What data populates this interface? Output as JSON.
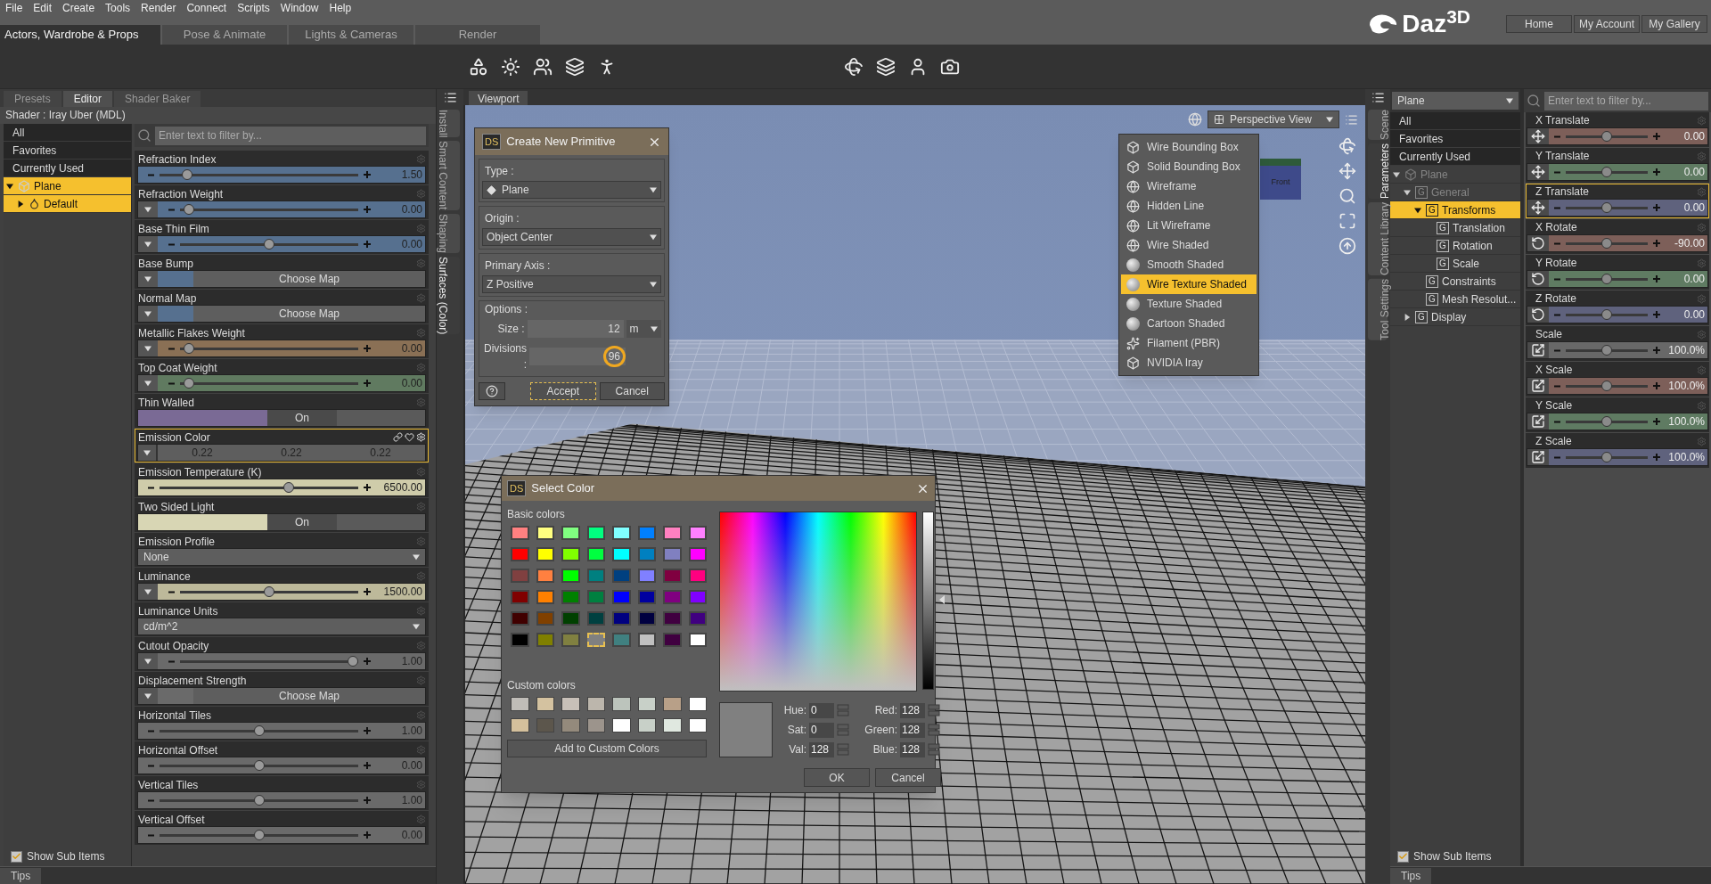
{
  "menu_bar": [
    "File",
    "Edit",
    "Create",
    "Tools",
    "Render",
    "Connect",
    "Scripts",
    "Window",
    "Help"
  ],
  "rooms": [
    {
      "label": "Actors, Wardrobe & Props",
      "selected": true
    },
    {
      "label": "Pose & Animate",
      "selected": false
    },
    {
      "label": "Lights & Cameras",
      "selected": false
    },
    {
      "label": "Render",
      "selected": false
    }
  ],
  "logo": "Daz$^{3D}$",
  "account_buttons": [
    "Home",
    "My Account",
    "My Gallery"
  ],
  "left_panel": {
    "tabs": [
      {
        "label": "Presets",
        "selected": false
      },
      {
        "label": "Editor",
        "selected": true
      },
      {
        "label": "Shader Baker",
        "selected": false
      }
    ],
    "shader": "Shader : Iray Uber (MDL)",
    "filters": [
      {
        "label": "All",
        "selected": false
      },
      {
        "label": "Favorites",
        "selected": false
      },
      {
        "label": "Currently Used",
        "selected": false
      }
    ],
    "tree": [
      {
        "label": "Plane",
        "kind": "node",
        "selected": true,
        "expanded": true,
        "children": [
          {
            "label": "Default",
            "kind": "material",
            "selected": true,
            "expanded": false
          }
        ]
      }
    ],
    "filter_placeholder": "Enter text to filter by...",
    "properties": [
      {
        "label": "Refraction Index",
        "kind": "slider",
        "menu": false,
        "level": 0.12,
        "value": "1.50",
        "color": "#56708f",
        "selected": false
      },
      {
        "label": "Refraction Weight",
        "kind": "slider",
        "menu": true,
        "level": 0.02,
        "value": "0.00",
        "color": "#56708f",
        "selected": false
      },
      {
        "label": "Base Thin Film",
        "kind": "slider",
        "menu": true,
        "level": 0.5,
        "value": "0.00",
        "color": "#56708f",
        "selected": false
      },
      {
        "label": "Base Bump",
        "kind": "map",
        "menu": true,
        "value": "Choose Map",
        "color": "#56708f",
        "selected": false
      },
      {
        "label": "Normal Map",
        "kind": "map",
        "menu": true,
        "value": "Choose Map",
        "color": "#56708f",
        "selected": false
      },
      {
        "label": "Metallic Flakes Weight",
        "kind": "slider",
        "menu": true,
        "level": 0.02,
        "value": "0.00",
        "color": "#8a7055",
        "selected": false
      },
      {
        "label": "Top Coat Weight",
        "kind": "slider",
        "menu": true,
        "level": 0.02,
        "value": "0.00",
        "color": "#607a60",
        "selected": false
      },
      {
        "label": "Thin Walled",
        "kind": "toggle",
        "value": "On",
        "color": "#7a6a95",
        "selected": false
      },
      {
        "label": "Emission Color",
        "kind": "color",
        "menu": true,
        "values": [
          "0.22",
          "0.22",
          "0.22"
        ],
        "selected": true
      },
      {
        "label": "Emission Temperature (K)",
        "kind": "slider",
        "menu": false,
        "level": 0.66,
        "value": "6500.00",
        "color": "#cfccaa",
        "selected": false
      },
      {
        "label": "Two Sided Light",
        "kind": "toggle",
        "value": "On",
        "color": "#d8d6b4",
        "selected": false
      },
      {
        "label": "Emission Profile",
        "kind": "dropdown",
        "value": "None",
        "selected": false
      },
      {
        "label": "Luminance",
        "kind": "slider",
        "menu": true,
        "level": 0.5,
        "value": "1500.00",
        "color": "#bdb99a",
        "selected": false
      },
      {
        "label": "Luminance Units",
        "kind": "dropdown",
        "value": "cd/m^2",
        "selected": false
      },
      {
        "label": "Cutout Opacity",
        "kind": "slider",
        "menu": true,
        "level": 1.0,
        "value": "1.00",
        "color": "#6a6a6a",
        "selected": false
      },
      {
        "label": "Displacement Strength",
        "kind": "map",
        "menu": true,
        "value": "Choose Map",
        "color": "#6a6a6a",
        "selected": false
      },
      {
        "label": "Horizontal Tiles",
        "kind": "slider",
        "menu": false,
        "level": 0.5,
        "value": "1.00",
        "color": "#6a6a6a",
        "selected": false
      },
      {
        "label": "Horizontal Offset",
        "kind": "slider",
        "menu": false,
        "level": 0.5,
        "value": "0.00",
        "color": "#6a6a6a",
        "selected": false
      },
      {
        "label": "Vertical Tiles",
        "kind": "slider",
        "menu": false,
        "level": 0.5,
        "value": "1.00",
        "color": "#6a6a6a",
        "selected": false
      },
      {
        "label": "Vertical Offset",
        "kind": "slider",
        "menu": false,
        "level": 0.5,
        "value": "0.00",
        "color": "#6a6a6a",
        "selected": false
      }
    ],
    "show_sub_items": {
      "label": "Show Sub Items",
      "checked": true
    },
    "tips": "Tips"
  },
  "left_side_tabs": [
    {
      "label": "Install",
      "selected": false
    },
    {
      "label": "Smart Content",
      "selected": false
    },
    {
      "label": "Shaping",
      "selected": false
    },
    {
      "label": "Surfaces (Color)",
      "selected": true
    }
  ],
  "viewport": {
    "tab": "Viewport",
    "view_menu": "Perspective View",
    "view_cube_label": "Front"
  },
  "primitive_dialog": {
    "badge": "DS",
    "title": "Create New Primitive",
    "groups": [
      {
        "label": "Type :",
        "value": "Plane",
        "with_icon": true
      },
      {
        "label": "Origin :",
        "value": "Object Center",
        "with_icon": false
      },
      {
        "label": "Primary Axis :",
        "value": "Z Positive",
        "with_icon": false
      }
    ],
    "options_label": "Options :",
    "size_label": "Size :",
    "size_value": "12",
    "unit": "m",
    "divisions_label": "Divisions :",
    "divisions_value": "96",
    "divisions_highlighted": true,
    "buttons": [
      {
        "label": "Accept",
        "focused": true
      },
      {
        "label": "Cancel",
        "focused": false
      }
    ]
  },
  "draw_style_menu": [
    {
      "label": "Wire Bounding Box",
      "kind": "box",
      "selected": false
    },
    {
      "label": "Solid Bounding Box",
      "kind": "box",
      "selected": false
    },
    {
      "label": "Wireframe",
      "kind": "wire",
      "selected": false
    },
    {
      "label": "Hidden Line",
      "kind": "wire",
      "selected": false
    },
    {
      "label": "Lit Wireframe",
      "kind": "wire",
      "selected": false
    },
    {
      "label": "Wire Shaded",
      "kind": "wire",
      "selected": false
    },
    {
      "label": "Smooth Shaded",
      "kind": "shaded",
      "selected": false
    },
    {
      "label": "Wire Texture Shaded",
      "kind": "shaded",
      "selected": true
    },
    {
      "label": "Texture Shaded",
      "kind": "shaded",
      "selected": false
    },
    {
      "label": "Cartoon Shaded",
      "kind": "shaded",
      "selected": false
    },
    {
      "label": "Filament (PBR)",
      "kind": "pbr",
      "selected": false
    },
    {
      "label": "NVIDIA Iray",
      "kind": "box",
      "selected": false
    }
  ],
  "color_dialog": {
    "badge": "DS",
    "title": "Select Color",
    "basic_label": "Basic colors",
    "basic_colors": [
      {
        "color": "#ff8080",
        "selected": false
      },
      {
        "color": "#ffff80",
        "selected": false
      },
      {
        "color": "#80ff80",
        "selected": false
      },
      {
        "color": "#00ff80",
        "selected": false
      },
      {
        "color": "#80ffff",
        "selected": false
      },
      {
        "color": "#0080ff",
        "selected": false
      },
      {
        "color": "#ff80c0",
        "selected": false
      },
      {
        "color": "#ff80ff",
        "selected": false
      },
      {
        "color": "#ff0000",
        "selected": false
      },
      {
        "color": "#ffff00",
        "selected": false
      },
      {
        "color": "#80ff00",
        "selected": false
      },
      {
        "color": "#00ff40",
        "selected": false
      },
      {
        "color": "#00ffff",
        "selected": false
      },
      {
        "color": "#0080c0",
        "selected": false
      },
      {
        "color": "#8080c0",
        "selected": false
      },
      {
        "color": "#ff00ff",
        "selected": false
      },
      {
        "color": "#804040",
        "selected": false
      },
      {
        "color": "#ff8040",
        "selected": false
      },
      {
        "color": "#00ff00",
        "selected": false
      },
      {
        "color": "#008080",
        "selected": false
      },
      {
        "color": "#004080",
        "selected": false
      },
      {
        "color": "#8080ff",
        "selected": false
      },
      {
        "color": "#800040",
        "selected": false
      },
      {
        "color": "#ff0080",
        "selected": false
      },
      {
        "color": "#800000",
        "selected": false
      },
      {
        "color": "#ff8000",
        "selected": false
      },
      {
        "color": "#008000",
        "selected": false
      },
      {
        "color": "#008040",
        "selected": false
      },
      {
        "color": "#0000ff",
        "selected": false
      },
      {
        "color": "#0000a0",
        "selected": false
      },
      {
        "color": "#800080",
        "selected": false
      },
      {
        "color": "#8000ff",
        "selected": false
      },
      {
        "color": "#400000",
        "selected": false
      },
      {
        "color": "#804000",
        "selected": false
      },
      {
        "color": "#004000",
        "selected": false
      },
      {
        "color": "#004040",
        "selected": false
      },
      {
        "color": "#000080",
        "selected": false
      },
      {
        "color": "#000040",
        "selected": false
      },
      {
        "color": "#400040",
        "selected": false
      },
      {
        "color": "#400080",
        "selected": false
      },
      {
        "color": "#000000",
        "selected": false
      },
      {
        "color": "#808000",
        "selected": false
      },
      {
        "color": "#808040",
        "selected": false
      },
      {
        "color": "#808080",
        "selected": true
      },
      {
        "color": "#408080",
        "selected": false
      },
      {
        "color": "#c0c0c0",
        "selected": false
      },
      {
        "color": "#400040",
        "selected": false
      },
      {
        "color": "#ffffff",
        "selected": false
      }
    ],
    "custom_label": "Custom colors",
    "custom_colors": [
      {
        "color": "#c0bdb8"
      },
      {
        "color": "#d4c2a0"
      },
      {
        "color": "#c8c0b8"
      },
      {
        "color": "#bcb6ac"
      },
      {
        "color": "#bcc4bc"
      },
      {
        "color": "#c8d0c8"
      },
      {
        "color": "#b8a088"
      },
      {
        "color": "#ffffff"
      },
      {
        "color": "#d4c09c"
      },
      {
        "color": "#5c564c"
      },
      {
        "color": "#948a7c"
      },
      {
        "color": "#9c948c"
      },
      {
        "color": "#ffffff"
      },
      {
        "color": "#c8d0c8"
      },
      {
        "color": "#e0e8e0"
      },
      {
        "color": "#ffffff"
      }
    ],
    "add_button": "Add to Custom Colors",
    "fields": [
      {
        "label": "Hue:",
        "value": "0"
      },
      {
        "label": "Red:",
        "value": "128"
      },
      {
        "label": "Sat:",
        "value": "0"
      },
      {
        "label": "Green:",
        "value": "128"
      },
      {
        "label": "Val:",
        "value": "128"
      },
      {
        "label": "Blue:",
        "value": "128"
      }
    ],
    "buttons": [
      "OK",
      "Cancel"
    ]
  },
  "right_side_tabs": [
    {
      "label": "Scene",
      "selected": false
    },
    {
      "label": "Parameters",
      "selected": true
    },
    {
      "label": "Content Library",
      "selected": false
    },
    {
      "label": "Tool Settings",
      "selected": false
    }
  ],
  "scene_panel": {
    "node": "Plane",
    "filters": [
      {
        "label": "All",
        "selected": false
      },
      {
        "label": "Favorites",
        "selected": false
      },
      {
        "label": "Currently Used",
        "selected": false
      }
    ],
    "tree": [
      {
        "label": "Plane",
        "kind": "node",
        "dimmed": true,
        "selected": false,
        "expanded": true,
        "children": [
          {
            "label": "General",
            "kind": "group",
            "badge": "G",
            "dimmed": true,
            "selected": false,
            "expanded": true,
            "children": [
              {
                "label": "Transforms",
                "kind": "group",
                "badge": "G",
                "dimmed": false,
                "selected": true,
                "expanded": true,
                "children": [
                  {
                    "label": "Translation",
                    "kind": "group",
                    "badge": "G",
                    "dimmed": false,
                    "selected": false
                  },
                  {
                    "label": "Rotation",
                    "kind": "group",
                    "badge": "G",
                    "dimmed": false,
                    "selected": false
                  },
                  {
                    "label": "Scale",
                    "kind": "group",
                    "badge": "G",
                    "dimmed": false,
                    "selected": false
                  }
                ]
              },
              {
                "label": "Constraints",
                "kind": "group",
                "badge": "G",
                "dimmed": false,
                "selected": false
              },
              {
                "label": "Mesh Resolut...",
                "kind": "group",
                "badge": "G",
                "dimmed": false,
                "selected": false
              }
            ]
          },
          {
            "label": "Display",
            "kind": "group",
            "badge": "G",
            "dimmed": false,
            "selected": false,
            "expanded": false
          }
        ]
      }
    ],
    "show_sub_items": {
      "label": "Show Sub Items",
      "checked": true
    },
    "filter_placeholder": "Enter text to filter by...",
    "parameters": [
      {
        "label": "X Translate",
        "kind": "translate",
        "level": 0.5,
        "value": "0.00",
        "color": "#7d5f59",
        "selected": false
      },
      {
        "label": "Y Translate",
        "kind": "translate",
        "level": 0.5,
        "value": "0.00",
        "color": "#5f7b62",
        "selected": false
      },
      {
        "label": "Z Translate",
        "kind": "translate",
        "level": 0.5,
        "value": "0.00",
        "color": "#5f627d",
        "selected": true
      },
      {
        "label": "X Rotate",
        "kind": "rotate",
        "level": 0.5,
        "value": "-90.00",
        "color": "#7d5f59",
        "selected": false
      },
      {
        "label": "Y Rotate",
        "kind": "rotate",
        "level": 0.5,
        "value": "0.00",
        "color": "#5f7b62",
        "selected": false
      },
      {
        "label": "Z Rotate",
        "kind": "rotate",
        "level": 0.5,
        "value": "0.00",
        "color": "#5f627d",
        "selected": false
      },
      {
        "label": "Scale",
        "kind": "scale",
        "level": 0.5,
        "value": "100.0%",
        "color": "#686868",
        "selected": false
      },
      {
        "label": "X Scale",
        "kind": "scale",
        "level": 0.5,
        "value": "100.0%",
        "color": "#7d5f59",
        "selected": false
      },
      {
        "label": "Y Scale",
        "kind": "scale",
        "level": 0.5,
        "value": "100.0%",
        "color": "#5f7b62",
        "selected": false
      },
      {
        "label": "Z Scale",
        "kind": "scale",
        "level": 0.5,
        "value": "100.0%",
        "color": "#5f627d",
        "selected": false
      }
    ],
    "tips": "Tips"
  }
}
